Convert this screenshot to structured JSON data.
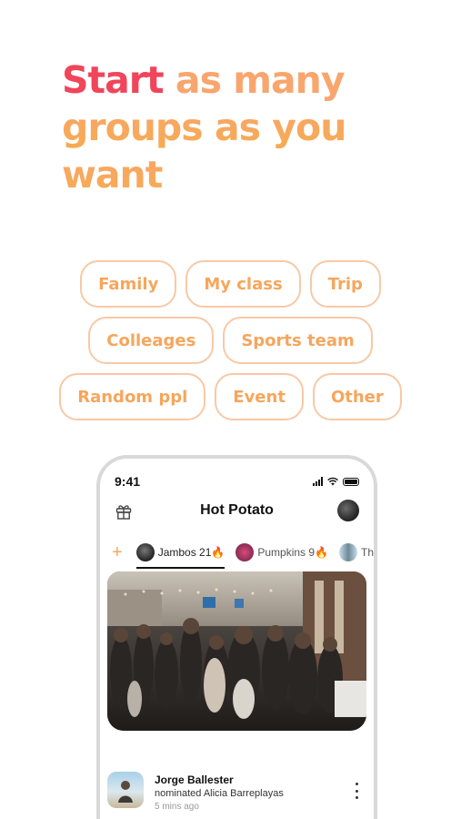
{
  "headline": {
    "word_start": "Start",
    "line1_rest": " as many",
    "line2": "groups as you",
    "line3": "want"
  },
  "chips": [
    [
      "Family",
      "My class",
      "Trip"
    ],
    [
      "Colleages",
      "Sports team"
    ],
    [
      "Random ppl",
      "Event",
      "Other"
    ]
  ],
  "phone": {
    "time": "9:41",
    "title": "Hot Potato",
    "tabs": {
      "add": "+",
      "items": [
        {
          "label": "Jambos 21🔥",
          "active": true
        },
        {
          "label": "Pumpkins 9🔥",
          "active": false
        },
        {
          "label": "Th",
          "active": false
        }
      ]
    },
    "post": {
      "name": "Jorge Ballester",
      "action": "nominated Alicia Barreplayas",
      "time": "5 mins ago"
    }
  },
  "colors": {
    "accent_red": "#f0455a",
    "accent_orange": "#f6a65c",
    "chip_border": "#f7c9a6"
  }
}
